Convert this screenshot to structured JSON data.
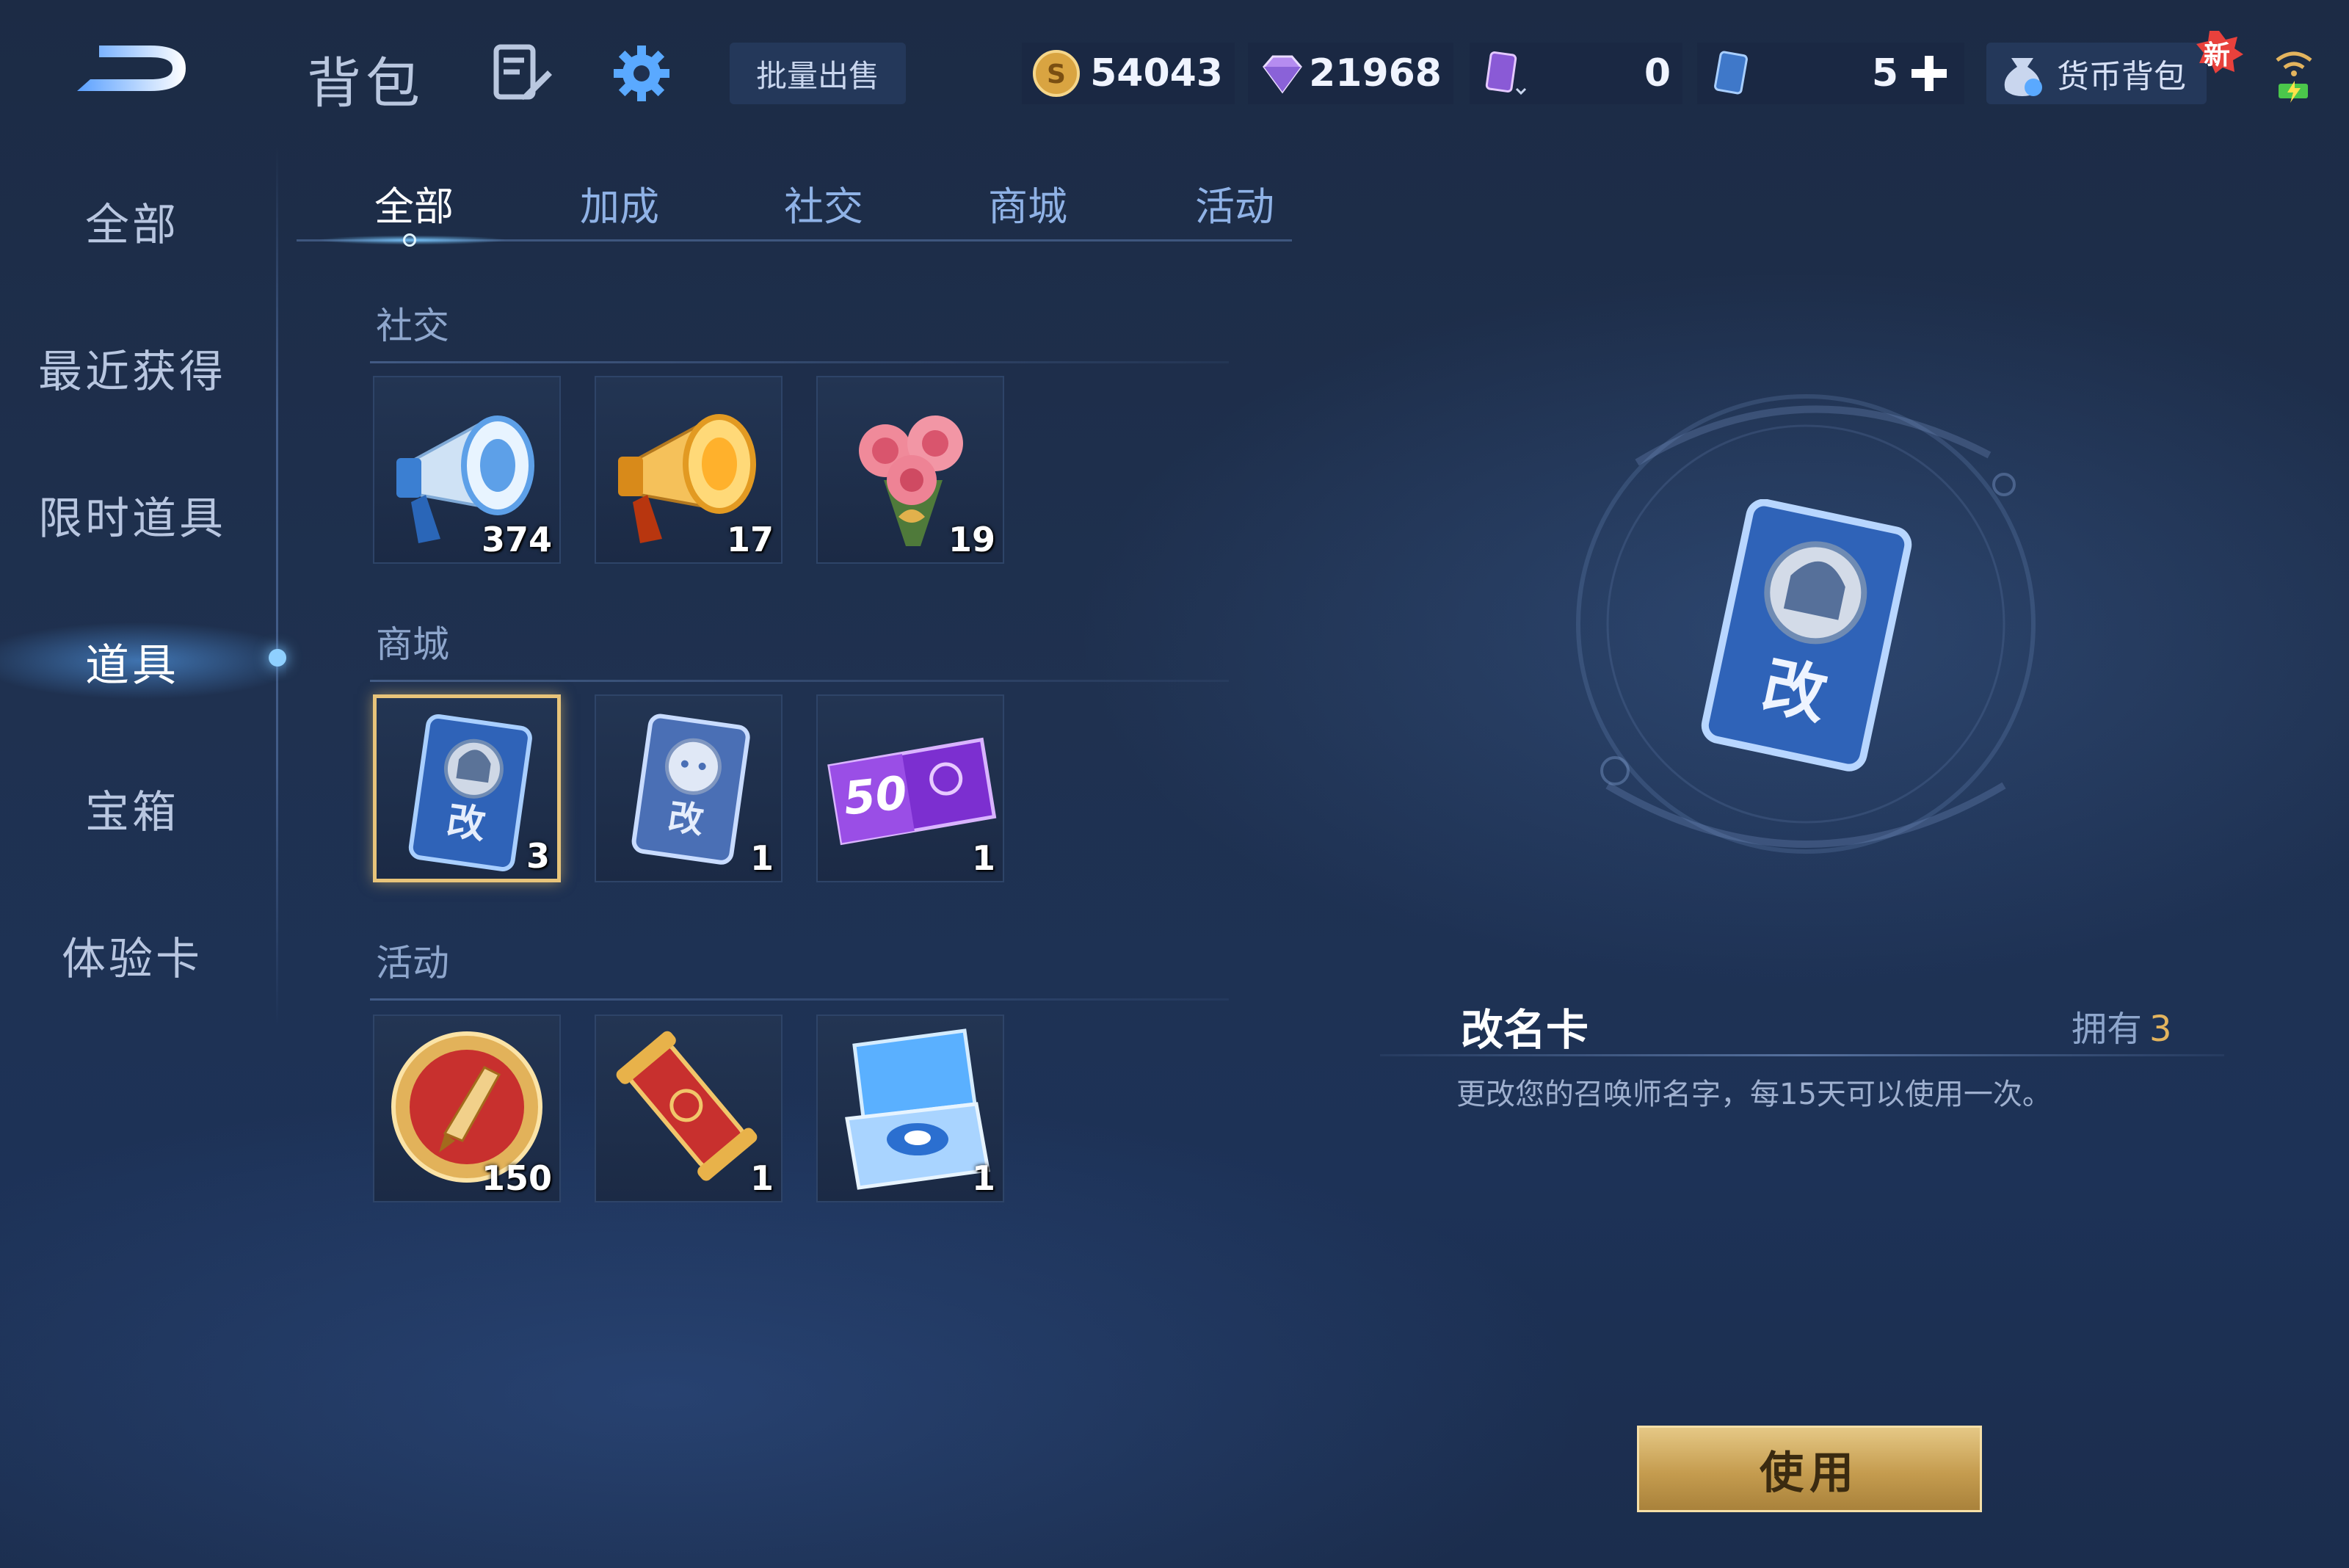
{
  "header": {
    "title": "背包",
    "batch_sell_label": "批量出售",
    "wallet_label": "货币背包",
    "new_badge": "新"
  },
  "currencies": {
    "gold": "54043",
    "gem": "21968",
    "ticket": "0",
    "card": "5"
  },
  "sidebar": {
    "items": [
      {
        "label": "全部"
      },
      {
        "label": "最近获得"
      },
      {
        "label": "限时道具"
      },
      {
        "label": "道具",
        "active": true
      },
      {
        "label": "宝箱"
      },
      {
        "label": "体验卡"
      }
    ]
  },
  "tabs": [
    {
      "label": "全部",
      "active": true
    },
    {
      "label": "加成"
    },
    {
      "label": "社交"
    },
    {
      "label": "商城"
    },
    {
      "label": "活动"
    }
  ],
  "sections": [
    {
      "title": "社交",
      "items": [
        {
          "icon": "blue-megaphone-icon",
          "count": "374"
        },
        {
          "icon": "gold-megaphone-icon",
          "count": "17"
        },
        {
          "icon": "rose-bouquet-icon",
          "count": "19"
        }
      ]
    },
    {
      "title": "商城",
      "items": [
        {
          "icon": "rename-card-icon",
          "count": "3",
          "selected": true
        },
        {
          "icon": "pet-rename-card-icon",
          "count": "1"
        },
        {
          "icon": "coupon-50-icon",
          "count": "1",
          "text": "50"
        }
      ]
    },
    {
      "title": "活动",
      "items": [
        {
          "icon": "quill-medal-icon",
          "count": "150"
        },
        {
          "icon": "scroll-icon",
          "count": "1"
        },
        {
          "icon": "jewel-box-icon",
          "count": "1"
        }
      ]
    }
  ],
  "detail": {
    "name": "改名卡",
    "owned_label": "拥有",
    "owned_value": "3",
    "description": "更改您的召唤师名字，每15天可以使用一次。",
    "card_glyph": "改",
    "use_label": "使用"
  },
  "colors": {
    "accent_gold": "#e3b45e",
    "selection_border": "#e8c47a",
    "card_blue": "#2f63b8"
  }
}
